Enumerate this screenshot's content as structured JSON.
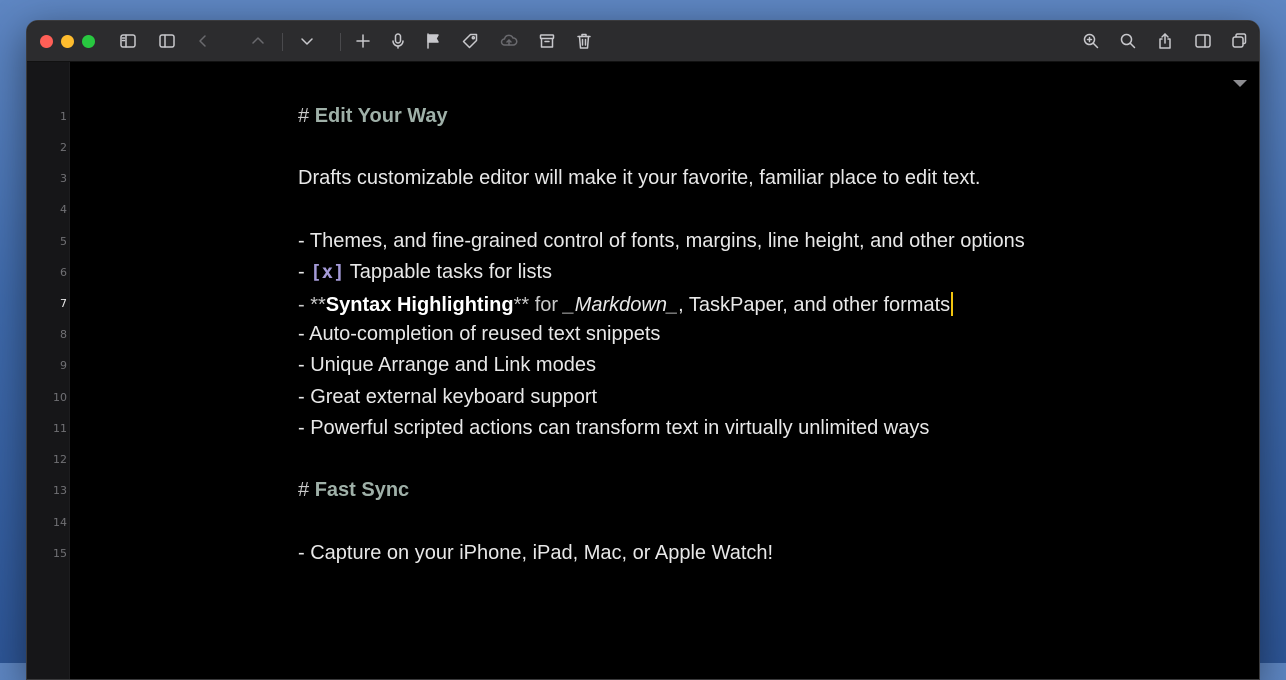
{
  "toolbar": {
    "left_icons": [
      "sidebar-icon",
      "panel-icon",
      "back-chevron-icon",
      "up-chevron-icon",
      "down-chevron-icon",
      "plus-icon",
      "microphone-icon",
      "flag-icon",
      "tag-icon",
      "cloud-upload-icon",
      "archive-icon",
      "trash-icon"
    ],
    "right_icons": [
      "zoom-icon",
      "search-icon",
      "share-icon",
      "split-view-icon",
      "window-icon"
    ]
  },
  "colors": {
    "heading": "#9fb0a8",
    "task": "#a59bd8",
    "caret": "#f1c40f",
    "current_line": "#1e1e20"
  },
  "gutter": {
    "line_numbers": [
      "1",
      "2",
      "3",
      "4",
      "5",
      "6",
      "7",
      "8",
      "9",
      "10",
      "11",
      "12",
      "13",
      "14",
      "15"
    ],
    "active_line": "7"
  },
  "editor": {
    "line1": {
      "marker": "# ",
      "text": "Edit Your Way"
    },
    "line3": "Drafts customizable editor will make it your favorite, familiar place to edit text.",
    "line5": "- Themes, and fine-grained control of fonts, margins, line height, and other options",
    "line6": {
      "prefix": "- ",
      "task": "[x]",
      "text": " Tappable tasks for lists"
    },
    "line7": {
      "prefix": "- **",
      "bold": "Syntax Highlighting",
      "mid": "** for ",
      "italic": "_Markdown_",
      "suffix": ", TaskPaper, and other formats"
    },
    "line8": "- Auto-completion of reused text snippets",
    "line9": "- Unique Arrange and Link modes",
    "line10": "- Great external keyboard support",
    "line11": "- Powerful scripted actions can transform text in virtually unlimited ways",
    "line13": {
      "marker": "# ",
      "text": "Fast Sync"
    },
    "line15": "- Capture on your iPhone, iPad, Mac, or Apple Watch!"
  }
}
